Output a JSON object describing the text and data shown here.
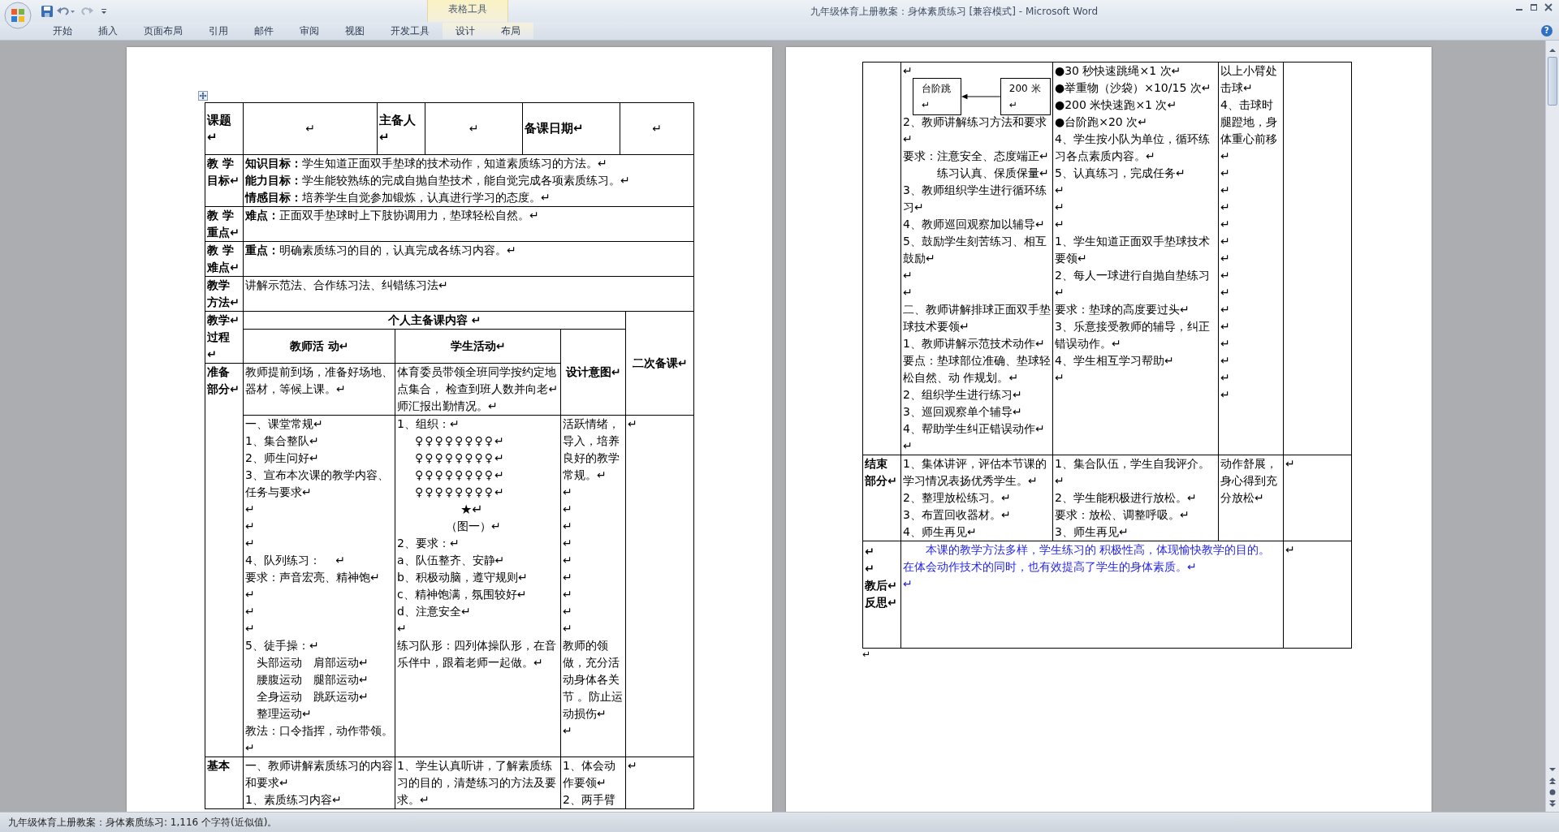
{
  "window": {
    "title": "九年级体育上册教案：身体素质练习 [兼容模式] - Microsoft Word"
  },
  "quick_access": [
    {
      "kind": "save"
    },
    {
      "kind": "undo"
    },
    {
      "kind": "redo"
    },
    {
      "kind": "customize"
    }
  ],
  "window_controls": [
    {
      "kind": "minimize"
    },
    {
      "kind": "maximize"
    },
    {
      "kind": "close"
    }
  ],
  "contextual_group": {
    "label": "表格工具"
  },
  "ribbon_tabs": [
    {
      "label": "开始",
      "selected": false,
      "contextual": false
    },
    {
      "label": "插入",
      "selected": false,
      "contextual": false
    },
    {
      "label": "页面布局",
      "selected": false,
      "contextual": false
    },
    {
      "label": "引用",
      "selected": false,
      "contextual": false
    },
    {
      "label": "邮件",
      "selected": false,
      "contextual": false
    },
    {
      "label": "审阅",
      "selected": false,
      "contextual": false
    },
    {
      "label": "视图",
      "selected": false,
      "contextual": false
    },
    {
      "label": "开发工具",
      "selected": false,
      "contextual": false
    },
    {
      "label": "设计",
      "selected": false,
      "contextual": true
    },
    {
      "label": "布局",
      "selected": false,
      "contextual": true
    }
  ],
  "help_button": {
    "label": "?"
  },
  "pages": [
    {
      "kind": "first",
      "table_handle": true,
      "header_table": [
        {
          "kind": "heading",
          "lines": [
            "课题↵"
          ]
        },
        {
          "kind": "body",
          "lines": [
            "↵"
          ]
        },
        {
          "kind": "heading",
          "lines": [
            "主备人↵"
          ]
        },
        {
          "kind": "body",
          "lines": [
            "↵"
          ]
        },
        {
          "kind": "heading",
          "lines": [
            "备课日期↵"
          ]
        },
        {
          "kind": "body",
          "lines": [
            "↵"
          ]
        }
      ],
      "rows": [
        {
          "kind": "wide",
          "cells": [
            {
              "kind": "heading",
              "lines": [
                "教 学",
                "目标↵"
              ]
            },
            {
              "kind": "body",
              "colspan": 4,
              "lines": [
                "**知识目标：**学生知道正面双手垫球的技术动作，知道素质练习的方法。↵",
                "**能力目标：**学生能较熟练的完成自抛自垫技术，能自觉完成各项素质练习。↵",
                "**情感目标：**培养学生自觉参加锻炼，认真进行学习的态度。↵"
              ]
            }
          ]
        },
        {
          "kind": "wide",
          "cells": [
            {
              "kind": "heading",
              "lines": [
                "教 学",
                "重点↵"
              ]
            },
            {
              "kind": "body",
              "colspan": 4,
              "lines": [
                "**难点：**正面双手垫球时上下肢协调用力，垫球轻松自然。↵"
              ]
            }
          ]
        },
        {
          "kind": "wide",
          "cells": [
            {
              "kind": "heading",
              "lines": [
                "教 学",
                "难点↵"
              ]
            },
            {
              "kind": "body",
              "colspan": 4,
              "lines": [
                "**重点：**明确素质练习的目的，认真完成各练习内容。↵"
              ]
            }
          ]
        },
        {
          "kind": "wide",
          "cells": [
            {
              "kind": "heading",
              "lines": [
                "教学",
                "方法↵"
              ]
            },
            {
              "kind": "body",
              "colspan": 4,
              "lines": [
                "讲解示范法、合作练习法、纠错练习法↵"
              ]
            }
          ]
        },
        {
          "kind": "process_head",
          "cells": [
            {
              "kind": "heading",
              "rowspan": 2,
              "lines": [
                "教学↵",
                "过程",
                "↵"
              ]
            },
            {
              "kind": "heading",
              "colspan": 3,
              "lines": [
                "个人主备课内容 ↵"
              ]
            },
            {
              "kind": "heading",
              "rowspan": 3,
              "lines": [
                "二次备课↵"
              ]
            }
          ]
        },
        {
          "kind": "process_subhead",
          "cells": [
            {
              "kind": "heading",
              "lines": [
                "教师活 动↵"
              ]
            },
            {
              "kind": "heading",
              "lines": [
                "学生活动↵"
              ]
            },
            {
              "kind": "heading",
              "rowspan": 2,
              "lines": [
                "设计意图↵"
              ]
            }
          ]
        },
        {
          "kind": "activity_open",
          "cells": [
            {
              "kind": "heading",
              "rowspan": 2,
              "lines": [
                "准备",
                "部分↵"
              ]
            },
            {
              "kind": "body",
              "lines": [
                "教师提前到场，准备好场地、器材，等候上课。↵"
              ]
            },
            {
              "kind": "body",
              "lines": [
                "体育委员带领全班同学按约定地点集合， 检查到班人数并向老↵",
                "师汇报出勤情况。↵"
              ]
            }
          ]
        },
        {
          "kind": "activity_cont",
          "cells": [
            {
              "kind": "body",
              "lines": [
                "一、课堂常规↵",
                "1、集合整队↵",
                "2、师生问好↵",
                "3、宣布本次课的教学内容、任务与要求↵",
                "↵",
                "↵",
                "↵",
                "4、队列练习：　 ↵",
                "要求：声音宏亮、精神饱↵",
                "↵",
                "↵",
                "↵",
                "5、徒手操：↵",
                "　头部运动　肩部运动↵",
                "　腰腹运动　腿部运动↵",
                "　全身运动　跳跃运动↵",
                "　整理运动↵",
                "教法：口令指挥，动作带领。↵"
              ]
            },
            {
              "kind": "body",
              "lines": [
                "1、组织：↵"
              ],
              "figure": {
                "kind": "formation",
                "rows": [
                  "♀♀♀♀♀♀♀♀↵",
                  "♀♀♀♀♀♀♀♀↵",
                  "♀♀♀♀♀♀♀♀↵",
                  "♀♀♀♀♀♀♀♀↵"
                ],
                "mark": "★↵",
                "caption": "（图一）↵"
              },
              "after": [
                "2、要求：↵",
                "a、队伍整齐、安静↵",
                "b、积极动脑，遵守规则↵",
                "c、精神饱满，氛围较好↵",
                "d、注意安全↵",
                "↵",
                "练习队形：四列体操队形，在音乐伴中，跟着老师一起做。↵"
              ]
            },
            {
              "kind": "body",
              "lines": [
                "活跃情绪，导入，培养良好的教学常规。↵",
                "↵",
                "↵",
                "↵",
                "↵",
                "↵",
                "↵",
                "↵",
                "↵",
                "↵",
                "教师的领做，充分活动身体各关节 。防止运动损伤↵",
                "↵"
              ]
            },
            {
              "kind": "body",
              "lines": [
                "↵"
              ]
            }
          ]
        },
        {
          "kind": "activity",
          "cells": [
            {
              "kind": "heading",
              "lines": [
                "基本"
              ]
            },
            {
              "kind": "body",
              "lines": [
                "一、教师讲解素质练习的内容和要求↵",
                "1、素质练习内容↵"
              ]
            },
            {
              "kind": "body",
              "lines": [
                "1、学生认真听讲，了解素质练习的目的，清楚练习的方法及要求。↵"
              ]
            },
            {
              "kind": "body",
              "lines": [
                "1、体会动作要领↵",
                "2、两手臂"
              ]
            },
            {
              "kind": "body",
              "lines": [
                "↵"
              ]
            }
          ]
        }
      ]
    },
    {
      "kind": "continued",
      "table_handle": false,
      "rows": [
        {
          "kind": "activity",
          "cells": [
            {
              "kind": "body"
            },
            {
              "kind": "body",
              "lines": [
                "↵"
              ],
              "figure": {
                "kind": "flow",
                "boxes": [
                  "台阶跳↵",
                  "200 米↵"
                ]
              },
              "after": [
                "2、教师讲解练习方法和要求↵",
                "要求：注意安全、态度端正↵",
                "　　　练习认真、保质保量↵",
                "3、教师组织学生进行循环练习↵",
                "4、教师巡回观察加以辅导↵",
                "5、鼓励学生刻苦练习、相互鼓励↵",
                "↵",
                "↵",
                "二、教师讲解排球正面双手垫球技术要领↵",
                "1、教师讲解示范技术动作↵",
                "要点：垫球部位准确、垫球轻松自然、动 作规划。↵",
                "2、组织学生进行练习↵",
                "3、巡回观察单个辅导↵",
                "4、帮助学生纠正错误动作↵",
                "↵"
              ]
            },
            {
              "kind": "body",
              "lines": [
                "●30 秒快速跳绳×1 次↵",
                "●举重物（沙袋）×10/15 次↵",
                "●200 米快速跑×1 次↵",
                "●台阶跑×20 次↵",
                "4、学生按小队为单位，循环练习各点素质内容。↵",
                "5、认真练习，完成任务↵",
                "↵",
                "↵",
                "↵",
                "1、学生知道正面双手垫球技术要领↵",
                "2、每人一球进行自抛自垫练习↵",
                "要求：垫球的高度要过头↵",
                "3、乐意接受教师的辅导，纠正错误动作。↵",
                "4、学生相互学习帮助↵",
                "↵"
              ]
            },
            {
              "kind": "body",
              "lines": [
                "以上小臂处击球↵",
                "4、击球时腿蹬地，身体重心前移↵",
                "↵",
                "↵",
                "↵",
                "↵",
                "↵",
                "↵",
                "↵",
                "↵",
                "↵",
                "↵",
                "↵",
                "↵",
                "↵",
                "↵"
              ]
            },
            {
              "kind": "body"
            }
          ]
        },
        {
          "kind": "activity",
          "cells": [
            {
              "kind": "heading",
              "lines": [
                "结束",
                "部分↵"
              ]
            },
            {
              "kind": "body",
              "lines": [
                "1、集体讲评，评估本节课的学习情况表扬优秀学生。↵",
                "2、整理放松练习。↵",
                "3、布置回收器材。↵",
                "4、师生再见↵"
              ]
            },
            {
              "kind": "body",
              "lines": [
                "1、集合队伍，学生自我评介。↵",
                "2、学生能积极进行放松。↵",
                "要求：放松、调整呼吸。↵",
                "3、师生再见↵"
              ]
            },
            {
              "kind": "body",
              "lines": [
                "动作舒展，身心得到充分放松↵"
              ]
            },
            {
              "kind": "body",
              "lines": [
                "↵"
              ]
            }
          ]
        },
        {
          "kind": "reflection",
          "cells": [
            {
              "kind": "heading",
              "lines": [
                "↵",
                "↵",
                "教后↵",
                "反思↵"
              ]
            },
            {
              "kind": "note",
              "colspan": 3,
              "lines": [
                "本课的教学方法多样，学生练习的 积极性高，体现愉快教学的目的。在体会动作技术的同时，也有效提高了学生的身体素质。↵",
                "↵"
              ]
            },
            {
              "kind": "body",
              "lines": [
                "↵"
              ]
            }
          ]
        }
      ],
      "after_table": [
        "↵"
      ]
    }
  ],
  "status_bar": {
    "text": "九年级体育上册教案：身体素质练习: 1,116 个字符(近似值)。"
  }
}
